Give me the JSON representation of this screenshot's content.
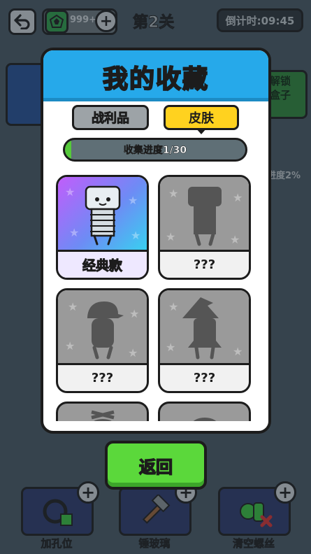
{
  "topbar": {
    "coins": "999+",
    "level": "第2关",
    "timer": "倒计时:09:45"
  },
  "background": {
    "unlock_box": "解锁\n盒子",
    "progress": "进度2%"
  },
  "tools": [
    {
      "label": "加孔位",
      "icon": "hole-ring-icon"
    },
    {
      "label": "锤玻璃",
      "icon": "hammer-icon"
    },
    {
      "label": "清空螺丝",
      "icon": "clear-screws-icon"
    }
  ],
  "modal": {
    "title": "我的收藏",
    "tabs": [
      {
        "label": "战利品",
        "selected": false
      },
      {
        "label": "皮肤",
        "selected": true
      }
    ],
    "progress_label": "收集进度1/30",
    "progress_fraction": 0.0333,
    "skins": [
      {
        "name": "经典款",
        "unlocked": true
      },
      {
        "name": "???",
        "unlocked": false
      },
      {
        "name": "???",
        "unlocked": false
      },
      {
        "name": "???",
        "unlocked": false
      }
    ],
    "return_label": "返回"
  },
  "colors": {
    "header_blue": "#26a9ea",
    "tab_selected": "#ffd21f",
    "progress_green": "#55c93a",
    "return_green": "#5bd83b"
  }
}
